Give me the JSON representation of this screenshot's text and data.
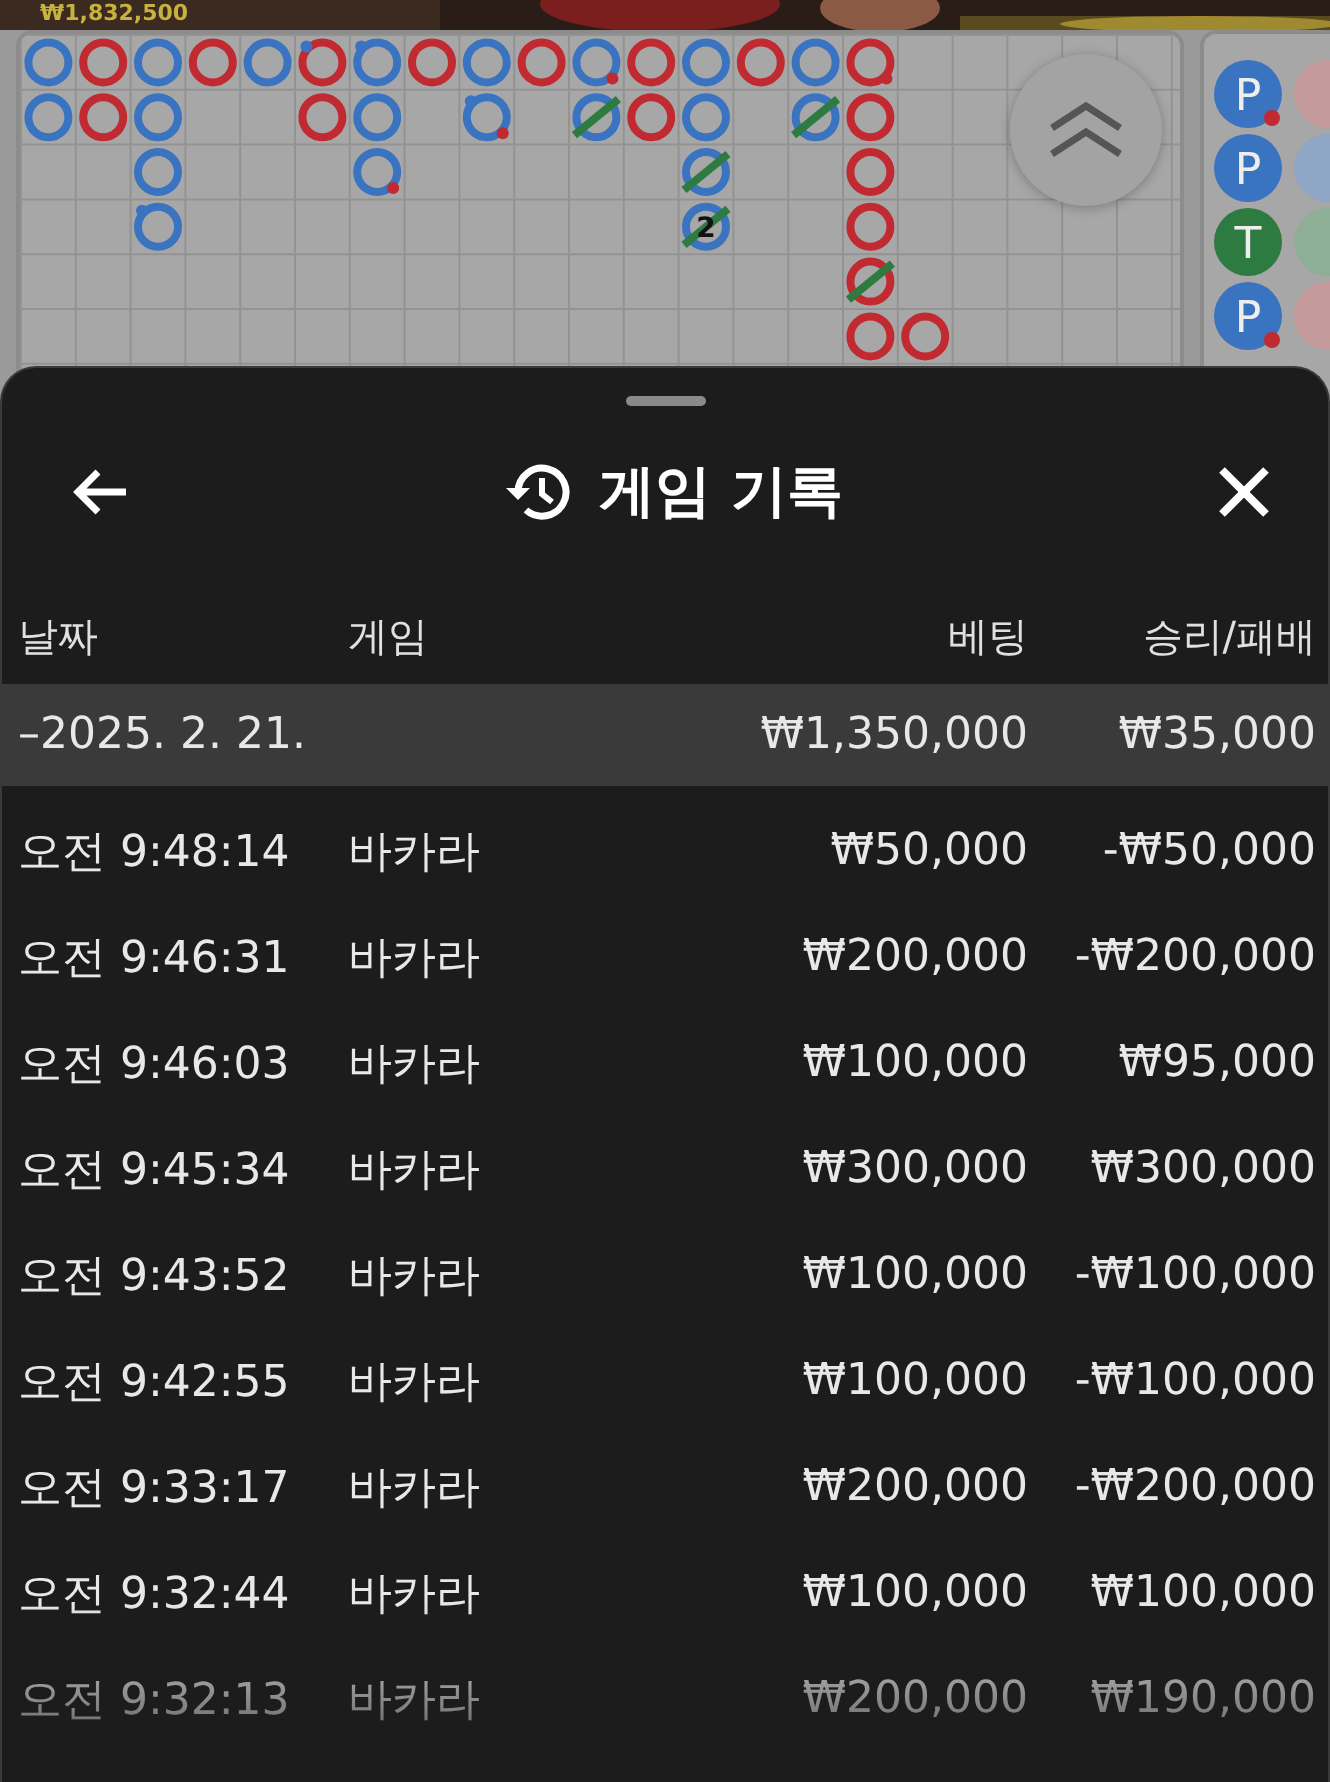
{
  "top_strip": {
    "balance": "₩1,832,500"
  },
  "big_road": {
    "columns": [
      [
        {
          "kind": "player",
          "tie": false,
          "player_pair": false,
          "banker_pair": false
        },
        {
          "kind": "player",
          "tie": false,
          "player_pair": false,
          "banker_pair": false
        }
      ],
      [
        {
          "kind": "banker",
          "tie": false,
          "player_pair": false,
          "banker_pair": false
        },
        {
          "kind": "banker",
          "tie": false,
          "player_pair": false,
          "banker_pair": false
        }
      ],
      [
        {
          "kind": "player",
          "tie": false,
          "player_pair": false,
          "banker_pair": false
        },
        {
          "kind": "player",
          "tie": false,
          "player_pair": false,
          "banker_pair": false
        },
        {
          "kind": "player",
          "tie": false,
          "player_pair": false,
          "banker_pair": false
        },
        {
          "kind": "player",
          "tie": false,
          "player_pair": true,
          "banker_pair": false
        }
      ],
      [
        {
          "kind": "banker",
          "tie": false,
          "player_pair": false,
          "banker_pair": false
        }
      ],
      [
        {
          "kind": "player",
          "tie": false,
          "player_pair": false,
          "banker_pair": false
        }
      ],
      [
        {
          "kind": "banker",
          "tie": false,
          "player_pair": true,
          "banker_pair": false
        },
        {
          "kind": "banker",
          "tie": false,
          "player_pair": false,
          "banker_pair": false
        }
      ],
      [
        {
          "kind": "player",
          "tie": false,
          "player_pair": true,
          "banker_pair": false
        },
        {
          "kind": "player",
          "tie": false,
          "player_pair": false,
          "banker_pair": false
        },
        {
          "kind": "player",
          "tie": false,
          "player_pair": false,
          "banker_pair": true
        }
      ],
      [
        {
          "kind": "banker",
          "tie": false,
          "player_pair": false,
          "banker_pair": false
        }
      ],
      [
        {
          "kind": "player",
          "tie": false,
          "player_pair": false,
          "banker_pair": false
        },
        {
          "kind": "player",
          "tie": false,
          "player_pair": true,
          "banker_pair": true
        }
      ],
      [
        {
          "kind": "banker",
          "tie": false,
          "player_pair": false,
          "banker_pair": false
        }
      ],
      [
        {
          "kind": "player",
          "tie": false,
          "player_pair": false,
          "banker_pair": true
        },
        {
          "kind": "player",
          "tie": true,
          "player_pair": false,
          "banker_pair": false
        }
      ],
      [
        {
          "kind": "banker",
          "tie": false,
          "player_pair": false,
          "banker_pair": false
        },
        {
          "kind": "banker",
          "tie": false,
          "player_pair": false,
          "banker_pair": false
        }
      ],
      [
        {
          "kind": "player",
          "tie": false,
          "player_pair": false,
          "banker_pair": false
        },
        {
          "kind": "player",
          "tie": false,
          "player_pair": false,
          "banker_pair": false
        },
        {
          "kind": "player",
          "tie": true,
          "player_pair": false,
          "banker_pair": false
        },
        {
          "kind": "player",
          "tie": true,
          "player_pair": false,
          "banker_pair": false,
          "tie_count": "2"
        }
      ],
      [
        {
          "kind": "banker",
          "tie": false,
          "player_pair": false,
          "banker_pair": false
        }
      ],
      [
        {
          "kind": "player",
          "tie": false,
          "player_pair": false,
          "banker_pair": false
        },
        {
          "kind": "player",
          "tie": true,
          "player_pair": false,
          "banker_pair": false
        }
      ],
      [
        {
          "kind": "banker",
          "tie": false,
          "player_pair": false,
          "banker_pair": true
        },
        {
          "kind": "banker",
          "tie": false,
          "player_pair": false,
          "banker_pair": false
        },
        {
          "kind": "banker",
          "tie": false,
          "player_pair": false,
          "banker_pair": false
        },
        {
          "kind": "banker",
          "tie": false,
          "player_pair": false,
          "banker_pair": false
        },
        {
          "kind": "banker",
          "tie": true,
          "player_pair": false,
          "banker_pair": false
        },
        {
          "kind": "banker",
          "tie": false,
          "player_pair": false,
          "banker_pair": false
        }
      ],
      [
        null,
        null,
        null,
        null,
        null,
        {
          "kind": "banker",
          "tie": false,
          "player_pair": false,
          "banker_pair": false
        }
      ]
    ]
  },
  "bead_plate": {
    "columns": [
      [
        {
          "kind": "player",
          "letter": "P",
          "banker_pair": true
        },
        {
          "kind": "player",
          "letter": "P",
          "banker_pair": false
        },
        {
          "kind": "tie",
          "letter": "T",
          "banker_pair": false
        },
        {
          "kind": "player",
          "letter": "P",
          "banker_pair": true
        }
      ],
      [
        {
          "kind": "banker"
        },
        {
          "kind": "player"
        },
        {
          "kind": "tie"
        },
        {
          "kind": "banker"
        }
      ]
    ]
  },
  "history": {
    "title": "게임 기록",
    "columns": [
      "날짜",
      "게임",
      "베팅",
      "승리/패배"
    ],
    "date_group": {
      "date": "–2025. 2. 21.",
      "bet": "₩1,350,000",
      "result": "₩35,000"
    },
    "rows": [
      {
        "time": "오전 9:48:14",
        "game": "바카라",
        "bet": "₩50,000",
        "result": "-₩50,000"
      },
      {
        "time": "오전 9:46:31",
        "game": "바카라",
        "bet": "₩200,000",
        "result": "-₩200,000"
      },
      {
        "time": "오전 9:46:03",
        "game": "바카라",
        "bet": "₩100,000",
        "result": "₩95,000"
      },
      {
        "time": "오전 9:45:34",
        "game": "바카라",
        "bet": "₩300,000",
        "result": "₩300,000"
      },
      {
        "time": "오전 9:43:52",
        "game": "바카라",
        "bet": "₩100,000",
        "result": "-₩100,000"
      },
      {
        "time": "오전 9:42:55",
        "game": "바카라",
        "bet": "₩100,000",
        "result": "-₩100,000"
      },
      {
        "time": "오전 9:33:17",
        "game": "바카라",
        "bet": "₩200,000",
        "result": "-₩200,000"
      },
      {
        "time": "오전 9:32:44",
        "game": "바카라",
        "bet": "₩100,000",
        "result": "₩100,000"
      },
      {
        "time": "오전 9:32:13",
        "game": "바카라",
        "bet": "₩200,000",
        "result": "₩190,000"
      }
    ]
  }
}
